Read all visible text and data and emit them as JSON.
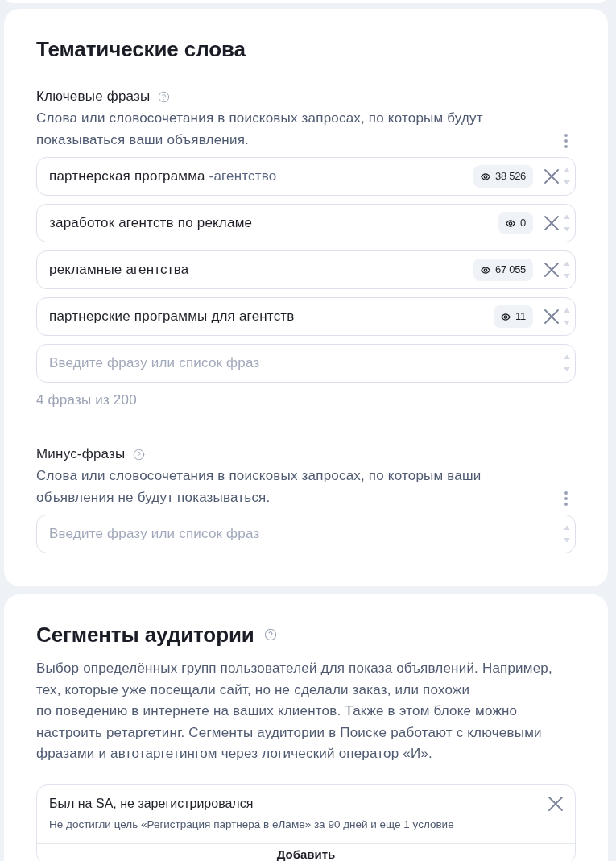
{
  "keywords_section": {
    "title": "Тематические слова",
    "keyword_phrases": {
      "label": "Ключевые фразы",
      "description": "Слова или словосочетания в поисковых запросах, по которым будут показываться ваши объявления.",
      "phrases": [
        {
          "text": "партнерская программа",
          "minus_words": "-агентство",
          "impressions": "38 526"
        },
        {
          "text": "заработок агентств по рекламе",
          "impressions": "0"
        },
        {
          "text": "рекламные агентства",
          "impressions": "67 055"
        },
        {
          "text": "партнерские программы для агентств",
          "impressions": "11"
        }
      ],
      "input": {
        "placeholder": "Введите фразу или список фраз"
      },
      "counter": "4 фразы из 200"
    },
    "negative_phrases": {
      "label": "Минус-фразы",
      "description": "Слова или словосочетания в поисковых запросах, по которым ваши объявления не будут показываться.",
      "input": {
        "placeholder": "Введите фразу или список фраз"
      }
    }
  },
  "audience_section": {
    "title": "Сегменты аудитории",
    "description": "Выбор определённых групп пользователей для показа объявлений. Например, тех, которые уже посещали сайт, но не сделали заказ, или похожи\nпо поведению в интернете на ваших клиентов. Также в этом блоке можно настроить ретаргетинг. Сегменты аудитории в Поиске работают с ключевыми фразами и автотаргетингом через логический оператор «И».",
    "segments": [
      {
        "name": "Был на SA, не зарегистрировался",
        "condition": "Не достигли цель «Регистрация партнера в еЛаме» за 90 дней и еще 1 условие"
      }
    ],
    "add_button": "Добавить"
  }
}
